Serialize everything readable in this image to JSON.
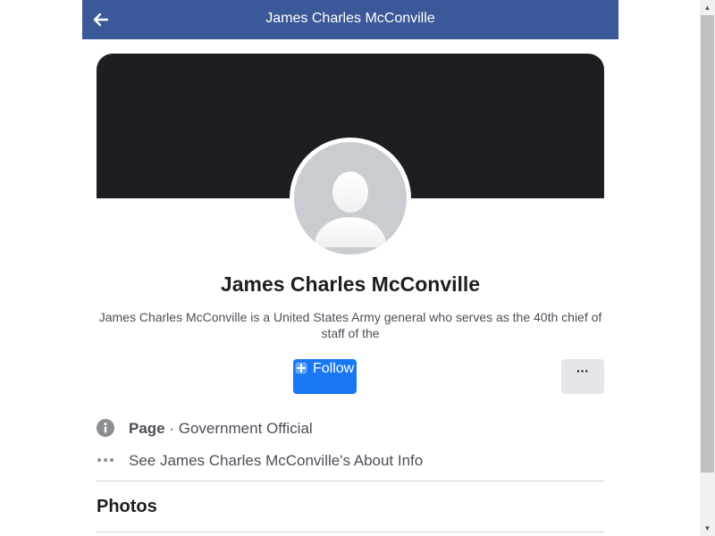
{
  "header": {
    "title": "James Charles McConville",
    "back_icon": "arrow-left-icon",
    "background": "#3b5998"
  },
  "profile": {
    "name": "James Charles McConville",
    "description": "James Charles McConville is a United States Army general who serves as the 40th chief of staff of the",
    "cover_color": "#1c1e21",
    "avatar_icon": "default-person-avatar"
  },
  "actions": {
    "follow_label": "Follow",
    "follow_icon": "follow-plus-icon",
    "follow_color": "#1877f2",
    "more_label": "···"
  },
  "info": {
    "page_label": "Page",
    "category": "· Government Official",
    "about_link": "See James Charles McConville's About Info"
  },
  "sections": {
    "photos_title": "Photos"
  }
}
